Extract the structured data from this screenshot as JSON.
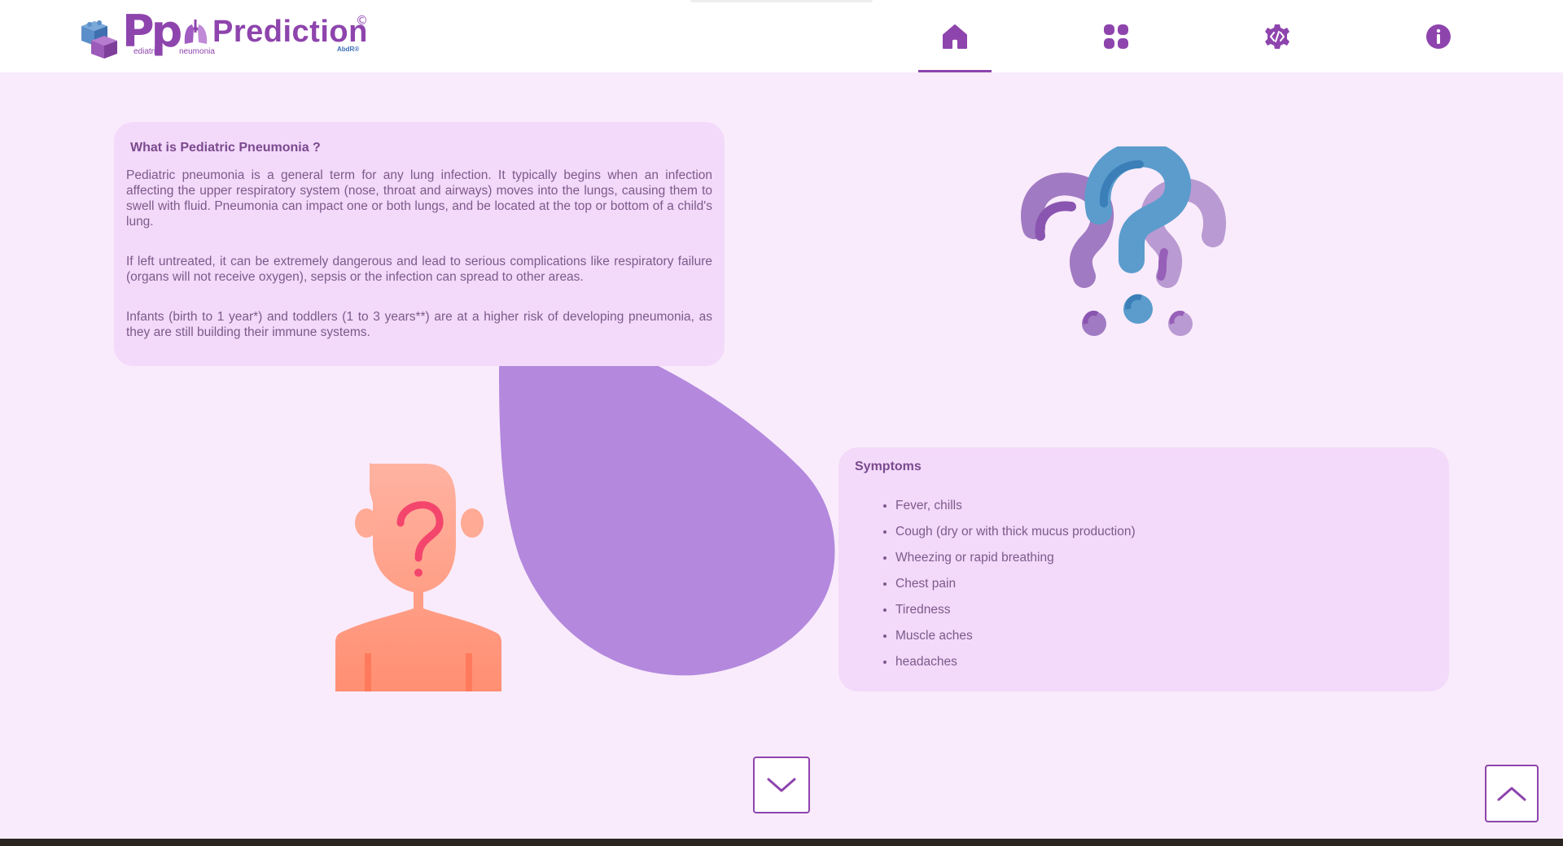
{
  "header": {
    "logo": {
      "mark": "Pp",
      "word": "Prediction",
      "copyright": "©",
      "sub_left": "ediatric",
      "sub_right": "neumonia",
      "author": "AbdR®"
    },
    "nav": [
      {
        "name": "home",
        "icon": "home-icon",
        "active": true
      },
      {
        "name": "apps",
        "icon": "grid-icon",
        "active": false
      },
      {
        "name": "developer",
        "icon": "code-gear-icon",
        "active": false
      },
      {
        "name": "info",
        "icon": "info-icon",
        "active": false
      }
    ]
  },
  "about": {
    "title": "What is Pediatric Pneumonia ?",
    "paragraphs": [
      "Pediatric pneumonia is a general term for any lung infection. It typically begins when an infection affecting the upper respiratory system (nose, throat and airways) moves into the lungs, causing them to swell with fluid. Pneumonia can impact one or both lungs, and be located at the top or bottom of a child's lung.",
      "If left untreated, it can be extremely dangerous and lead to serious complications like respiratory failure (organs will not receive oxygen), sepsis or the infection can spread to other areas.",
      "Infants (birth to 1 year*) and toddlers (1 to 3 years**) are at a higher risk of developing pneumonia, as they are still building their immune systems."
    ]
  },
  "symptoms": {
    "title": "Symptoms",
    "items": [
      "Fever, chills",
      "Cough (dry or with thick mucus production)",
      "Wheezing or rapid breathing",
      "Chest pain",
      "Tiredness",
      "Muscle aches",
      "headaches"
    ]
  },
  "illustrations": {
    "person": "person-question-icon",
    "questions": "question-marks-icon",
    "blob": "purple-blob"
  },
  "controls": {
    "scroll_down": "chevron-down-icon",
    "scroll_top": "chevron-up-icon"
  },
  "colors": {
    "accent": "#8e44ad",
    "background": "#f9ebfb",
    "card": "#f3d9fa",
    "blob": "#b388dd",
    "text": "#7d5a8a"
  }
}
